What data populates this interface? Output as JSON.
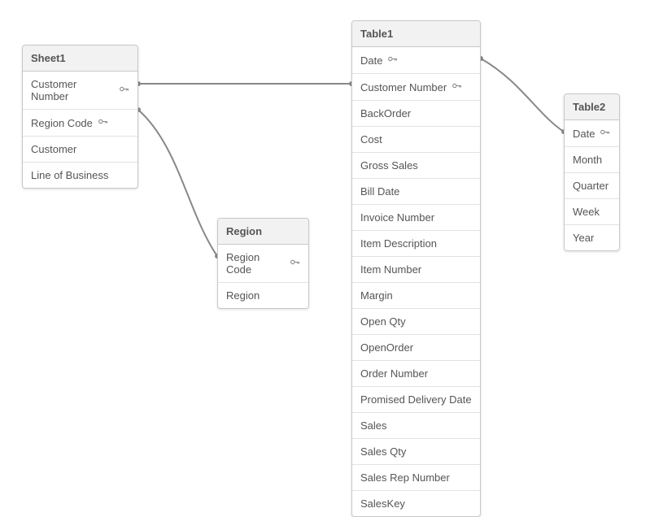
{
  "tables": {
    "sheet1": {
      "title": "Sheet1",
      "fields": [
        {
          "label": "Customer Number",
          "key": true
        },
        {
          "label": "Region Code",
          "key": true
        },
        {
          "label": "Customer",
          "key": false
        },
        {
          "label": "Line of Business",
          "key": false
        }
      ]
    },
    "region": {
      "title": "Region",
      "fields": [
        {
          "label": "Region Code",
          "key": true
        },
        {
          "label": "Region",
          "key": false
        }
      ]
    },
    "table1": {
      "title": "Table1",
      "fields": [
        {
          "label": "Date",
          "key": true
        },
        {
          "label": "Customer Number",
          "key": true
        },
        {
          "label": "BackOrder",
          "key": false
        },
        {
          "label": "Cost",
          "key": false
        },
        {
          "label": "Gross Sales",
          "key": false
        },
        {
          "label": "Bill Date",
          "key": false
        },
        {
          "label": "Invoice Number",
          "key": false
        },
        {
          "label": "Item Description",
          "key": false
        },
        {
          "label": "Item Number",
          "key": false
        },
        {
          "label": "Margin",
          "key": false
        },
        {
          "label": "Open Qty",
          "key": false
        },
        {
          "label": "OpenOrder",
          "key": false
        },
        {
          "label": "Order Number",
          "key": false
        },
        {
          "label": "Promised Delivery Date",
          "key": false
        },
        {
          "label": "Sales",
          "key": false
        },
        {
          "label": "Sales Qty",
          "key": false
        },
        {
          "label": "Sales Rep Number",
          "key": false
        },
        {
          "label": "SalesKey",
          "key": false
        }
      ]
    },
    "table2": {
      "title": "Table2",
      "fields": [
        {
          "label": "Date",
          "key": true
        },
        {
          "label": "Month",
          "key": false
        },
        {
          "label": "Quarter",
          "key": false
        },
        {
          "label": "Week",
          "key": false
        },
        {
          "label": "Year",
          "key": false
        }
      ]
    }
  },
  "relationships": [
    {
      "from": "sheet1.Customer Number",
      "to": "table1.Customer Number"
    },
    {
      "from": "sheet1.Region Code",
      "to": "region.Region Code"
    },
    {
      "from": "table1.Date",
      "to": "table2.Date"
    }
  ],
  "icons": {
    "key": "o-"
  }
}
